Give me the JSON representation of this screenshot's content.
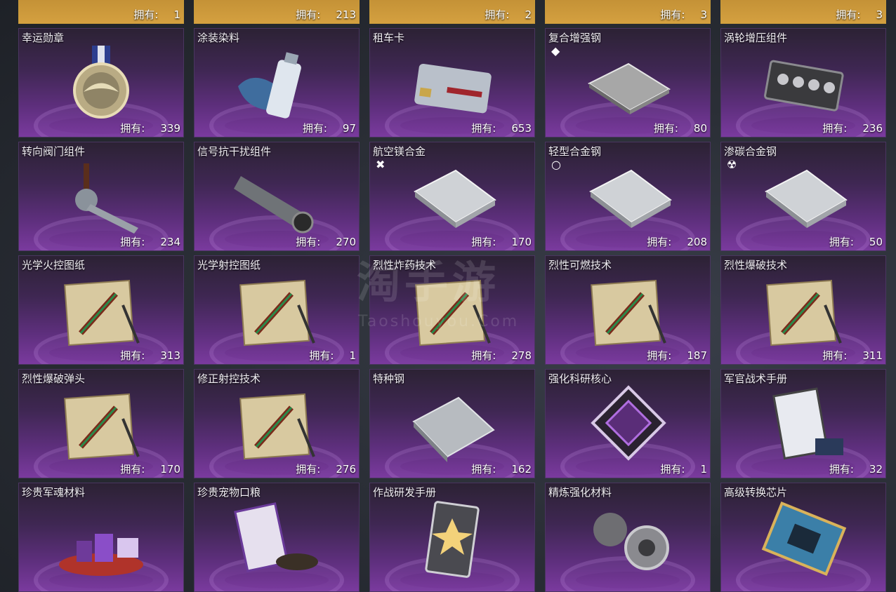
{
  "owned_label": "拥有:",
  "top_row": [
    {
      "count": "1"
    },
    {
      "count": "213"
    },
    {
      "count": "2"
    },
    {
      "count": "3"
    },
    {
      "count": "3"
    }
  ],
  "items": [
    {
      "name": "幸运勋章",
      "count": "339",
      "icon": "medal-icon"
    },
    {
      "name": "涂装染料",
      "count": "97",
      "icon": "spray-can-icon"
    },
    {
      "name": "租车卡",
      "count": "653",
      "icon": "card-icon"
    },
    {
      "name": "复合增强钢",
      "count": "80",
      "icon": "steel-plate-icon",
      "mark": "◆"
    },
    {
      "name": "涡轮增压组件",
      "count": "236",
      "icon": "engine-icon"
    },
    {
      "name": "转向阀门组件",
      "count": "234",
      "icon": "valve-icon"
    },
    {
      "name": "信号抗干扰组件",
      "count": "270",
      "icon": "scope-icon"
    },
    {
      "name": "航空镁合金",
      "count": "170",
      "icon": "alloy-sheet-icon",
      "mark": "✖"
    },
    {
      "name": "轻型合金钢",
      "count": "208",
      "icon": "alloy-sheet-icon",
      "mark": "○"
    },
    {
      "name": "渗碳合金钢",
      "count": "50",
      "icon": "alloy-sheet-icon",
      "mark": "☢"
    },
    {
      "name": "光学火控图纸",
      "count": "313",
      "icon": "blueprint-icon"
    },
    {
      "name": "光学射控图纸",
      "count": "1",
      "icon": "blueprint-icon"
    },
    {
      "name": "烈性炸药技术",
      "count": "278",
      "icon": "blueprint-icon"
    },
    {
      "name": "烈性可燃技术",
      "count": "187",
      "icon": "blueprint-icon"
    },
    {
      "name": "烈性爆破技术",
      "count": "311",
      "icon": "blueprint-icon"
    },
    {
      "name": "烈性爆破弹头",
      "count": "170",
      "icon": "blueprint-icon"
    },
    {
      "name": "修正射控技术",
      "count": "276",
      "icon": "blueprint-icon"
    },
    {
      "name": "特种钢",
      "count": "162",
      "icon": "ingot-icon"
    },
    {
      "name": "强化科研核心",
      "count": "1",
      "icon": "core-icon"
    },
    {
      "name": "军官战术手册",
      "count": "32",
      "icon": "manual-icon"
    },
    {
      "name": "珍贵军魂材料",
      "count": "",
      "icon": "potion-icon"
    },
    {
      "name": "珍贵宠物口粮",
      "count": "",
      "icon": "food-bag-icon"
    },
    {
      "name": "作战研发手册",
      "count": "",
      "icon": "research-card-icon"
    },
    {
      "name": "精炼强化材料",
      "count": "",
      "icon": "gear-icon"
    },
    {
      "name": "高级转换芯片",
      "count": "",
      "icon": "chip-icon"
    }
  ],
  "watermark": {
    "main": "淘手游",
    "sub": "Taoshouyou.Com"
  }
}
